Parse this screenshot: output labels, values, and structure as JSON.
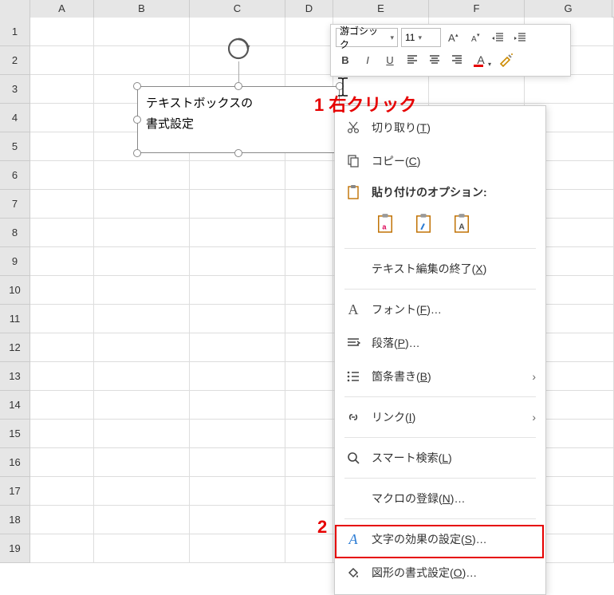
{
  "columns": [
    "A",
    "B",
    "C",
    "D",
    "E",
    "F",
    "G"
  ],
  "rows": [
    "1",
    "2",
    "3",
    "4",
    "5",
    "6",
    "7",
    "8",
    "9",
    "10",
    "11",
    "12",
    "13",
    "14",
    "15",
    "16",
    "17",
    "18",
    "19"
  ],
  "textbox": {
    "line1": "テキストボックスの",
    "line2": "書式設定"
  },
  "annotations": {
    "a1": "1 右クリック",
    "a2": "2"
  },
  "mini_toolbar": {
    "font_name": "游ゴシック",
    "font_size": "11",
    "bold": "B",
    "italic": "I",
    "underline": "U",
    "font_btn_a": "A"
  },
  "context_menu": {
    "cut": "切り取り(",
    "cut_k": "T",
    "cut_sfx": ")",
    "copy": "コピー(",
    "copy_k": "C",
    "copy_sfx": ")",
    "paste_options_label": "貼り付けのオプション:",
    "exit_edit": "テキスト編集の終了(",
    "exit_edit_k": "X",
    "exit_edit_sfx": ")",
    "font": "フォント(",
    "font_k": "F",
    "font_sfx": ")…",
    "paragraph": "段落(",
    "paragraph_k": "P",
    "paragraph_sfx": ")…",
    "bullets": "箇条書き(",
    "bullets_k": "B",
    "bullets_sfx": ")",
    "link": "リンク(",
    "link_k": "I",
    "link_sfx": ")",
    "smart_lookup": "スマート検索(",
    "smart_lookup_k": "L",
    "smart_lookup_sfx": ")",
    "macro": "マクロの登録(",
    "macro_k": "N",
    "macro_sfx": ")…",
    "text_effects": "文字の効果の設定(",
    "text_effects_k": "S",
    "text_effects_sfx": ")…",
    "format_shape": "図形の書式設定(",
    "format_shape_k": "O",
    "format_shape_sfx": ")…"
  }
}
